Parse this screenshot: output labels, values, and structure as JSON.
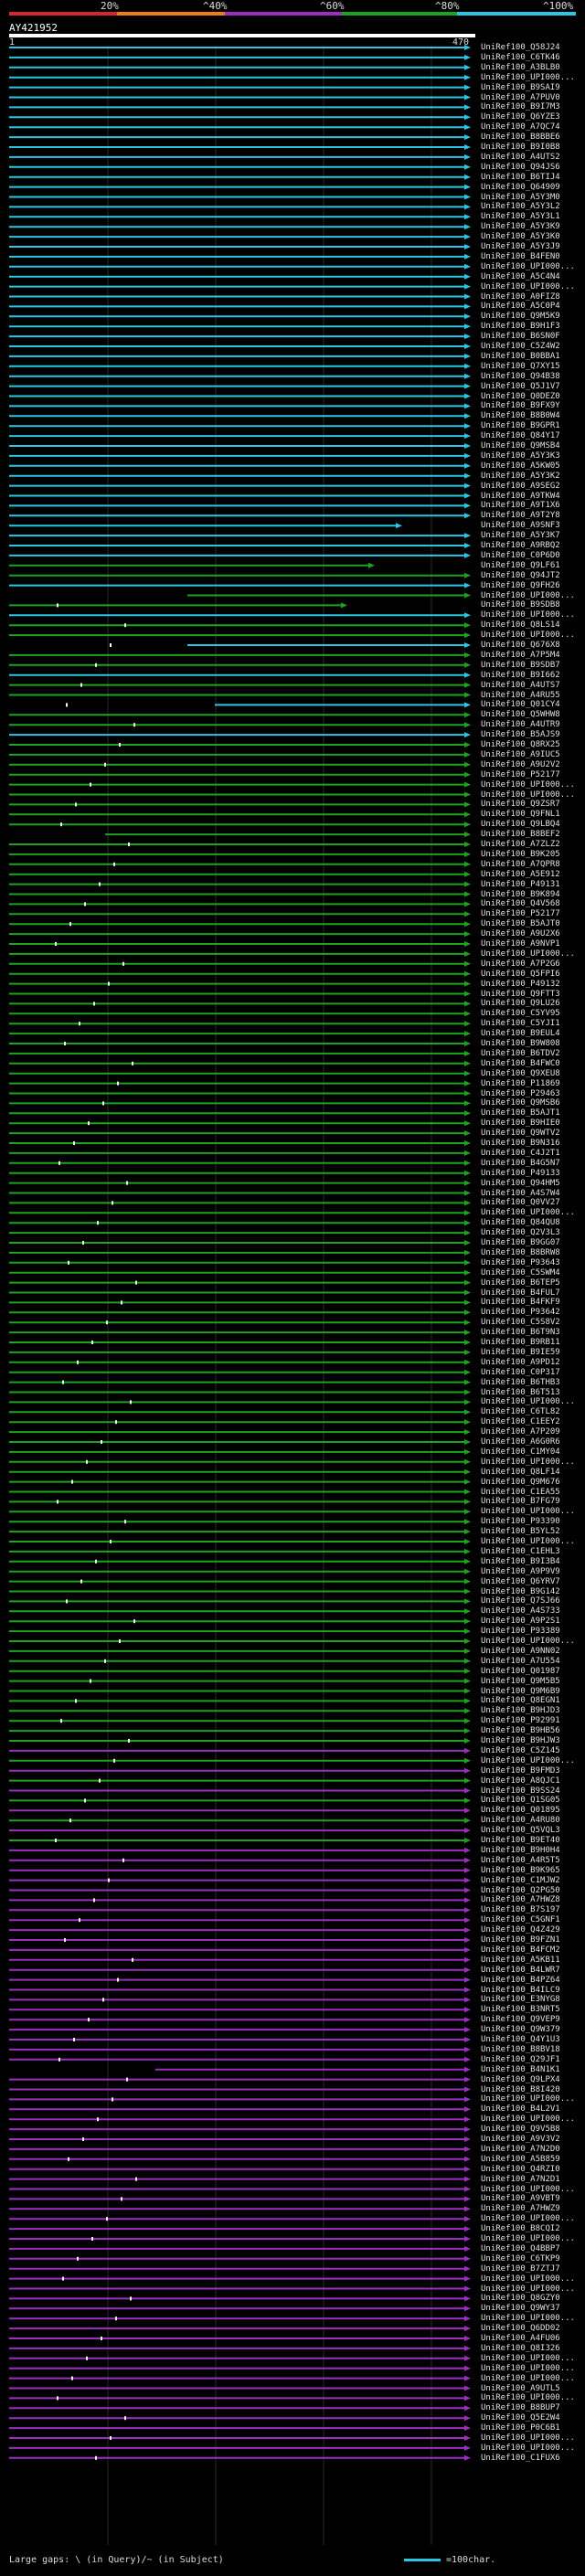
{
  "colorbar": {
    "labels": [
      "20%",
      "^40%",
      "^60%",
      "^80%",
      "^100%"
    ],
    "colors": [
      "#d62828",
      "#f07b1b",
      "#9b30c0",
      "#1ea31e",
      "#29c7e3"
    ]
  },
  "query": {
    "name": "AY421952",
    "start": "1",
    "end": "470"
  },
  "footer": {
    "legend": "Large gaps: \\ (in Query)/~ (in Subject)",
    "scale_label": "=100char."
  },
  "hits": [
    "UniRef100_Q58J24",
    "UniRef100_C6TK46",
    "UniRef100_A3BLB0",
    "UniRef100_UPI000...",
    "UniRef100_B9SAI9",
    "UniRef100_A7PUV0",
    "UniRef100_B9I7M3",
    "UniRef100_Q6YZE3",
    "UniRef100_A7QC74",
    "UniRef100_B8BBE6",
    "UniRef100_B9I0B8",
    "UniRef100_A4UTS2",
    "UniRef100_Q94JS6",
    "UniRef100_B6TIJ4",
    "UniRef100_Q64909",
    "UniRef100_A5Y3M0",
    "UniRef100_A5Y3L2",
    "UniRef100_A5Y3L1",
    "UniRef100_A5Y3K9",
    "UniRef100_A5Y3K0",
    "UniRef100_A5Y3J9",
    "UniRef100_B4FEN0",
    "UniRef100_UPI000...",
    "UniRef100_A5C4N4",
    "UniRef100_UPI000...",
    "UniRef100_A0FIZ8",
    "UniRef100_A5C0P4",
    "UniRef100_Q9M5K9",
    "UniRef100_B9H1F3",
    "UniRef100_B6SN0F",
    "UniRef100_C5Z4W2",
    "UniRef100_B0BBA1",
    "UniRef100_Q7XY15",
    "UniRef100_Q94B38",
    "UniRef100_Q5J1V7",
    "UniRef100_Q0DEZ0",
    "UniRef100_B9FX9Y",
    "UniRef100_B8B0W4",
    "UniRef100_B9GPR1",
    "UniRef100_Q84Y17",
    "UniRef100_Q9MSB4",
    "UniRef100_A5Y3K3",
    "UniRef100_A5KW05",
    "UniRef100_A5Y3K2",
    "UniRef100_A9SEG2",
    "UniRef100_A9TKW4",
    "UniRef100_A9T1X6",
    "UniRef100_A9T2Y8",
    "UniRef100_A9SNF3",
    "UniRef100_A5Y3K7",
    "UniRef100_A9RBQ2",
    "UniRef100_C0P6D0",
    "UniRef100_Q9LF61",
    "UniRef100_Q94JT2",
    "UniRef100_Q9FH26",
    "UniRef100_UPI000...",
    "UniRef100_B9SDB8",
    "UniRef100_UPI000...",
    "UniRef100_Q8LS14",
    "UniRef100_UPI000...",
    "UniRef100_Q676X8",
    "UniRef100_A7P5M4",
    "UniRef100_B9SDB7",
    "UniRef100_B9I662",
    "UniRef100_A4UTS7",
    "UniRef100_A4RU55",
    "UniRef100_Q01CY4",
    "UniRef100_Q5WHW8",
    "UniRef100_A4UTR9",
    "UniRef100_B5AJS9",
    "UniRef100_Q8RX25",
    "UniRef100_A9IUC5",
    "UniRef100_A9U2V2",
    "UniRef100_P52177",
    "UniRef100_UPI000...",
    "UniRef100_UPI000...",
    "UniRef100_Q9ZSR7",
    "UniRef100_Q9FNL1",
    "UniRef100_Q9LBQ4",
    "UniRef100_B8BEF2",
    "UniRef100_A7ZLZ2",
    "UniRef100_B9K205",
    "UniRef100_A7QPR8",
    "UniRef100_A5E912",
    "UniRef100_P49131",
    "UniRef100_B9K894",
    "UniRef100_Q4V568",
    "UniRef100_P52177",
    "UniRef100_B5AJT0",
    "UniRef100_A9U2X6",
    "UniRef100_A9NVP1",
    "UniRef100_UPI000...",
    "UniRef100_A7P2G6",
    "UniRef100_Q5FPI6",
    "UniRef100_P49132",
    "UniRef100_Q9FTT3",
    "UniRef100_Q9LU26",
    "UniRef100_C5YV95",
    "UniRef100_C5YJI1",
    "UniRef100_B9EUL4",
    "UniRef100_B9W808",
    "UniRef100_B6TDV2",
    "UniRef100_B4FWC0",
    "UniRef100_Q9XEU8",
    "UniRef100_P11869",
    "UniRef100_P29463",
    "UniRef100_Q9MSB6",
    "UniRef100_B5AJT1",
    "UniRef100_B9HIE0",
    "UniRef100_Q9WTV2",
    "UniRef100_B9N316",
    "UniRef100_C4J2T1",
    "UniRef100_B4G5N7",
    "UniRef100_P49133",
    "UniRef100_Q94HM5",
    "UniRef100_A4S7W4",
    "UniRef100_Q0VV27",
    "UniRef100_UPI000...",
    "UniRef100_Q84QU8",
    "UniRef100_Q2V3L3",
    "UniRef100_B9GG07",
    "UniRef100_B8BRW8",
    "UniRef100_P93643",
    "UniRef100_C5SWM4",
    "UniRef100_B6TEP5",
    "UniRef100_B4FUL7",
    "UniRef100_B4FKF9",
    "UniRef100_P93642",
    "UniRef100_C5S8V2",
    "UniRef100_B6T9N3",
    "UniRef100_B9RB11",
    "UniRef100_B9IE59",
    "UniRef100_A9PD12",
    "UniRef100_C0P317",
    "UniRef100_B6THB3",
    "UniRef100_B6T513",
    "UniRef100_UPI000...",
    "UniRef100_C6TL82",
    "UniRef100_C1EEY2",
    "UniRef100_A7P209",
    "UniRef100_A6G0R6",
    "UniRef100_C1MY04",
    "UniRef100_UPI000...",
    "UniRef100_Q8LF14",
    "UniRef100_Q9M676",
    "UniRef100_C1EA55",
    "UniRef100_B7FG79",
    "UniRef100_UPI000...",
    "UniRef100_P93390",
    "UniRef100_B5YL52",
    "UniRef100_UPI000...",
    "UniRef100_C1EHL3",
    "UniRef100_B9I3B4",
    "UniRef100_A9P9V9",
    "UniRef100_Q6YRV7",
    "UniRef100_B9G142",
    "UniRef100_Q7SJ66",
    "UniRef100_A4S733",
    "UniRef100_A9P2S1",
    "UniRef100_P93389",
    "UniRef100_UPI000...",
    "UniRef100_A9NN02",
    "UniRef100_A7U554",
    "UniRef100_Q01987",
    "UniRef100_Q9M5B5",
    "UniRef100_Q9M6B9",
    "UniRef100_Q8EGN1",
    "UniRef100_B9HJD3",
    "UniRef100_P92991",
    "UniRef100_B9HB56",
    "UniRef100_B9HJW3",
    "UniRef100_C5Z145",
    "UniRef100_UPI000...",
    "UniRef100_B9FMD3",
    "UniRef100_A8QJC1",
    "UniRef100_B9SS24",
    "UniRef100_Q1SG05",
    "UniRef100_Q01895",
    "UniRef100_A4RU80",
    "UniRef100_Q5VQL3",
    "UniRef100_B9ET40",
    "UniRef100_B9H0H4",
    "UniRef100_A4R5T5",
    "UniRef100_B9K965",
    "UniRef100_C1MJW2",
    "UniRef100_Q2PG50",
    "UniRef100_A7HWZ8",
    "UniRef100_B7S197",
    "UniRef100_C5GNF1",
    "UniRef100_Q4Z429",
    "UniRef100_B9FZN1",
    "UniRef100_B4FCM2",
    "UniRef100_A5KB11",
    "UniRef100_B4LWR7",
    "UniRef100_B4PZ64",
    "UniRef100_B4ILC9",
    "UniRef100_E3NYG8",
    "UniRef100_B3NRT5",
    "UniRef100_Q9VEP9",
    "UniRef100_Q9W379",
    "UniRef100_Q4Y1U3",
    "UniRef100_B8BV18",
    "UniRef100_Q29JF1",
    "UniRef100_B4N1K1",
    "UniRef100_Q9LPX4",
    "UniRef100_B8I420",
    "UniRef100_UPI000...",
    "UniRef100_B4L2V1",
    "UniRef100_UPI000...",
    "UniRef100_Q9V5B8",
    "UniRef100_A9V3V2",
    "UniRef100_A7N2D0",
    "UniRef100_A5B859",
    "UniRef100_Q4RZI0",
    "UniRef100_A7N2D1",
    "UniRef100_UPI000...",
    "UniRef100_A9VBT9",
    "UniRef100_A7HWZ9",
    "UniRef100_UPI000...",
    "UniRef100_B8CQI2",
    "UniRef100_UPI000...",
    "UniRef100_Q4BBP7",
    "UniRef100_C6TKP9",
    "UniRef100_B7ZTJ7",
    "UniRef100_UPI000...",
    "UniRef100_UPI000...",
    "UniRef100_Q8GZY0",
    "UniRef100_Q9WY37",
    "UniRef100_UPI000...",
    "UniRef100_Q6DD02",
    "UniRef100_A4FU06",
    "UniRef100_Q8I326",
    "UniRef100_UPI000...",
    "UniRef100_UPI000...",
    "UniRef100_UPI000...",
    "UniRef100_A9UTL5",
    "UniRef100_UPI000...",
    "UniRef100_B8BUP7",
    "UniRef100_Q5E2W4",
    "UniRef100_P0C6B1",
    "UniRef100_UPI000...",
    "UniRef100_UPI000...",
    "UniRef100_C1FUX6"
  ]
}
